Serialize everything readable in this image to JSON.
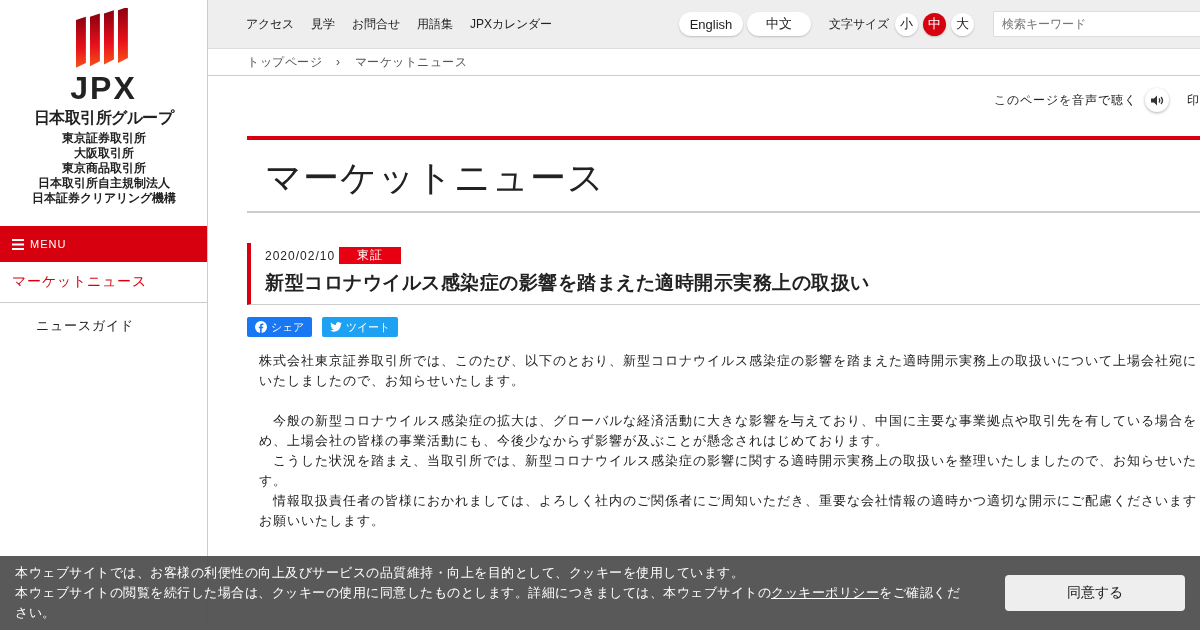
{
  "logo": {
    "mark": "JPX",
    "group": "日本取引所グループ",
    "companies": [
      "東京証券取引所",
      "大阪取引所",
      "東京商品取引所",
      "日本取引所自主規制法人",
      "日本証券クリアリング機構"
    ]
  },
  "menu": {
    "label": "MENU"
  },
  "sidebar": {
    "items": [
      {
        "label": "マーケットニュース",
        "selected": true,
        "children": [
          {
            "label": "ニュースガイド",
            "selected": false
          }
        ]
      }
    ]
  },
  "top_nav": {
    "links": [
      "アクセス",
      "見学",
      "お問合せ",
      "用語集",
      "JPXカレンダー"
    ],
    "languages": [
      "English",
      "中文"
    ],
    "font_size_label": "文字サイズ",
    "font_sizes": [
      {
        "label": "小",
        "selected": false
      },
      {
        "label": "中",
        "selected": true
      },
      {
        "label": "大",
        "selected": false
      }
    ],
    "search": {
      "placeholder": "検索キーワード"
    }
  },
  "breadcrumb": [
    "トップページ",
    "›",
    "マーケットニュース"
  ],
  "tools": {
    "listen": "このページを音声で聴く",
    "print": "印"
  },
  "page_title": "マーケットニュース",
  "article": {
    "date": "2020/02/10",
    "tag": "東証",
    "title": "新型コロナウイルス感染症の影響を踏まえた適時開示実務上の取扱い",
    "share": [
      "シェア",
      "ツイート"
    ],
    "paragraphs": [
      [
        "株式会社東京証券取引所では、このたび、以下のとおり、新型コロナウイルス感染症の影響を踏まえた適時開示実務上の取扱いについて上場会社宛に",
        "いたしましたので、お知らせいたします。"
      ],
      [
        "　今般の新型コロナウイルス感染症の拡大は、グローバルな経済活動に大きな影響を与えており、中国に主要な事業拠点や取引先を有している場合を",
        "め、上場会社の皆様の事業活動にも、今後少なからず影響が及ぶことが懸念されはじめております。",
        "　こうした状況を踏まえ、当取引所では、新型コロナウイルス感染症の影響に関する適時開示実務上の取扱いを整理いたしましたので、お知らせいた",
        "す。",
        "　情報取扱責任者の皆様におかれましては、よろしく社内のご関係者にご周知いただき、重要な会社情報の適時かつ適切な開示にご配慮くださいます",
        "お願いいたします。"
      ]
    ]
  },
  "cookie_banner": {
    "lines": [
      "本ウェブサイトでは、お客様の利便性の向上及びサービスの品質維持・向上を目的として、クッキーを使用しています。",
      "本ウェブサイトの閲覧を続行した場合は、クッキーの使用に同意したものとします。詳細につきましては、本ウェブサイトの"
    ],
    "link": "クッキーポリシー",
    "after_link": "をご確認くだ",
    "last_line": "さい。",
    "button": "同意する"
  }
}
